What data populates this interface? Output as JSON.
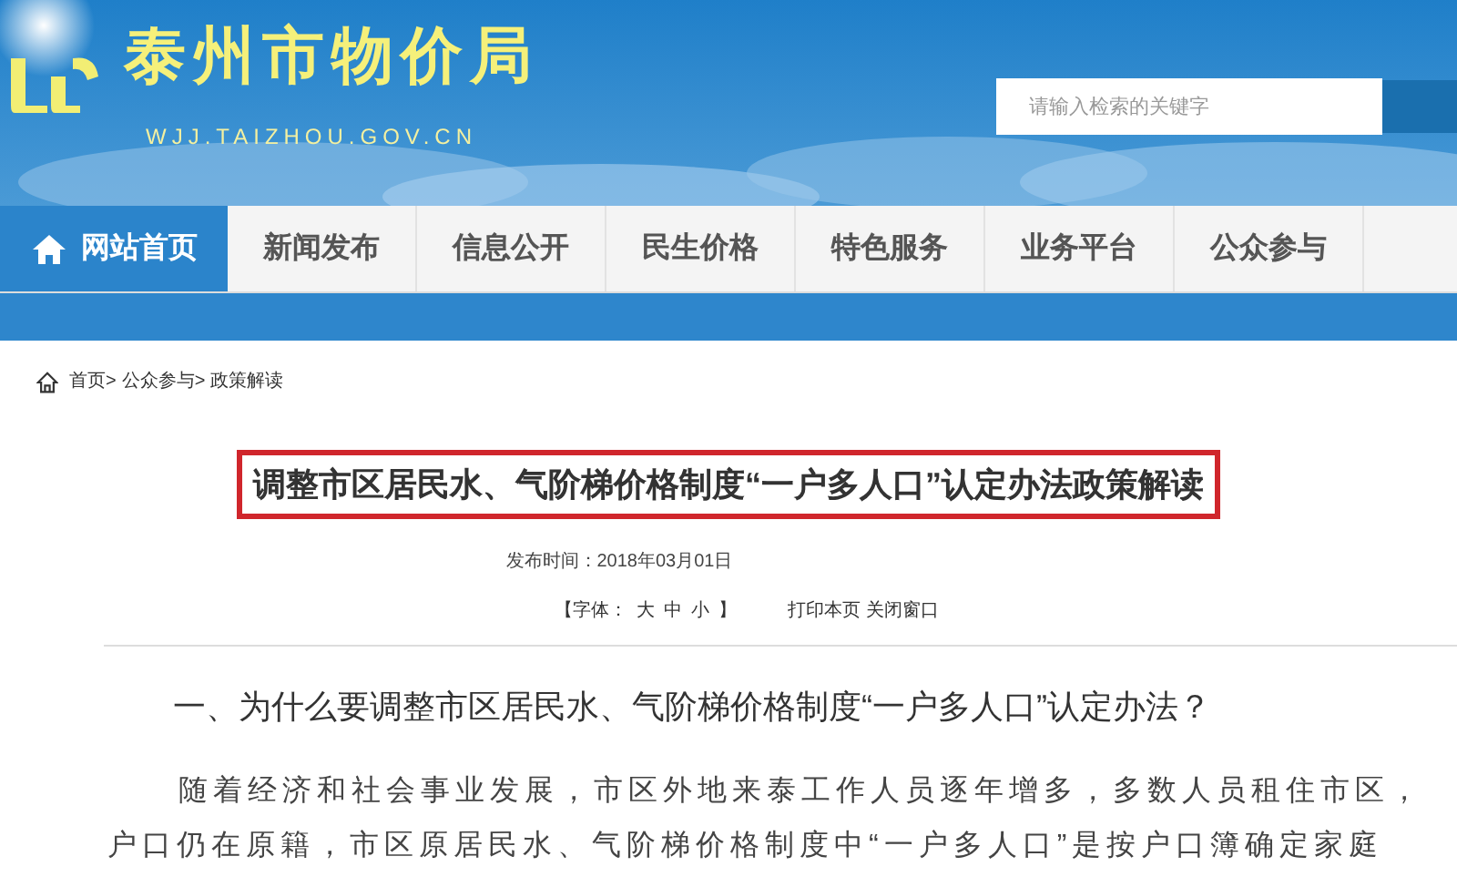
{
  "header": {
    "site_name": "泰州市物价局",
    "site_url": "WJJ.TAIZHOU.GOV.CN",
    "search": {
      "placeholder": "请输入检索的关键字"
    }
  },
  "nav": [
    {
      "label": "网站首页",
      "selected": true
    },
    {
      "label": "新闻发布",
      "selected": false
    },
    {
      "label": "信息公开",
      "selected": false
    },
    {
      "label": "民生价格",
      "selected": false
    },
    {
      "label": "特色服务",
      "selected": false
    },
    {
      "label": "业务平台",
      "selected": false
    },
    {
      "label": "公众参与",
      "selected": false
    }
  ],
  "breadcrumb": [
    "首页>",
    "公众参与>",
    "政策解读"
  ],
  "article": {
    "title": "调整市区居民水、气阶梯价格制度“一户多人口”认定办法政策解读",
    "publish_time": "发布时间：2018年03月01日",
    "font_size_label": "【字体：",
    "font_sizes": [
      "大",
      "中",
      "小"
    ],
    "font_size_close": "】",
    "print": "打印本页",
    "close": "关闭窗口",
    "heading": "一、为什么要调整市区居民水、气阶梯价格制度“一户多人口”认定办法？",
    "paragraph": "随着经济和社会事业发展，市区外地来泰工作人员逐年增多，多数人员租住市区，户口仍在原籍，市区原居民水、气阶梯价格制度中“一户多人口”是按户口簿确定家庭"
  }
}
